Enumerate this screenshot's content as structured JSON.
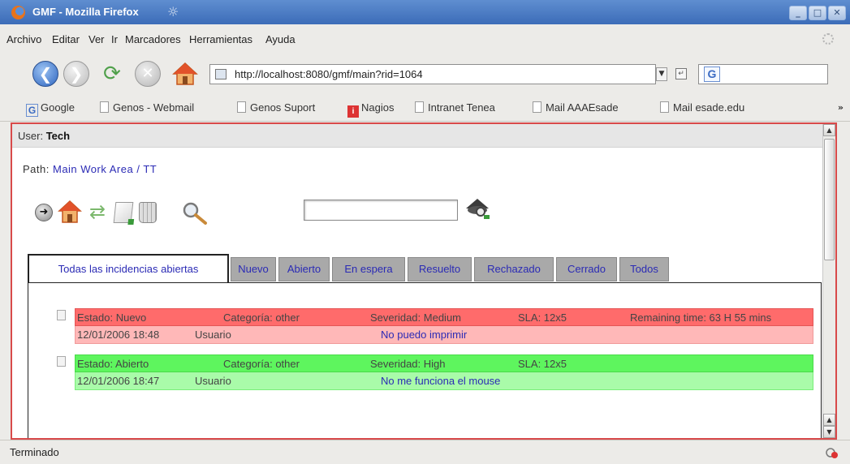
{
  "window": {
    "title": "GMF - Mozilla Firefox"
  },
  "menubar": {
    "items": [
      "Archivo",
      "Editar",
      "Ver",
      "Ir",
      "Marcadores",
      "Herramientas",
      "Ayuda"
    ]
  },
  "navbar": {
    "url": "http://localhost:8080/gmf/main?rid=1064",
    "search_value": ""
  },
  "bookmarks": [
    "Google",
    "Genos - Webmail",
    "Genos Suport",
    "Nagios",
    "Intranet Tenea",
    "Mail AAAEsade",
    "Mail esade.edu"
  ],
  "page": {
    "user_label": "User:",
    "user_value": "Tech",
    "path_label": "Path:",
    "path_value": "Main Work Area / TT",
    "search_value": "",
    "tabs": [
      "Todas las incidencias abiertas",
      "Nuevo",
      "Abierto",
      "En espera",
      "Resuelto",
      "Rechazado",
      "Cerrado",
      "Todos"
    ],
    "active_tab": "Todas las incidencias abiertas",
    "incidents": [
      {
        "estado": "Estado: Nuevo",
        "categoria": "Categoría: other",
        "severidad": "Severidad: Medium",
        "sla": "SLA: 12x5",
        "remaining": "Remaining time: 63 H 55 mins",
        "fecha": "12/01/2006 18:48",
        "usuario": "Usuario",
        "asunto": "No puedo imprimir",
        "color": "#ff6b6b"
      },
      {
        "estado": "Estado: Abierto",
        "categoria": "Categoría: other",
        "severidad": "Severidad: High",
        "sla": "SLA: 12x5",
        "remaining": "",
        "fecha": "12/01/2006 18:47",
        "usuario": "Usuario",
        "asunto": "No me funciona el mouse",
        "color": "#5ef55e"
      }
    ]
  },
  "status": {
    "text": "Terminado"
  },
  "colors": {
    "titlebar": "#4a7bc6",
    "frame_border": "#d84a4a",
    "link": "#2b2bb5",
    "tab_bg": "#a9a9a9"
  }
}
